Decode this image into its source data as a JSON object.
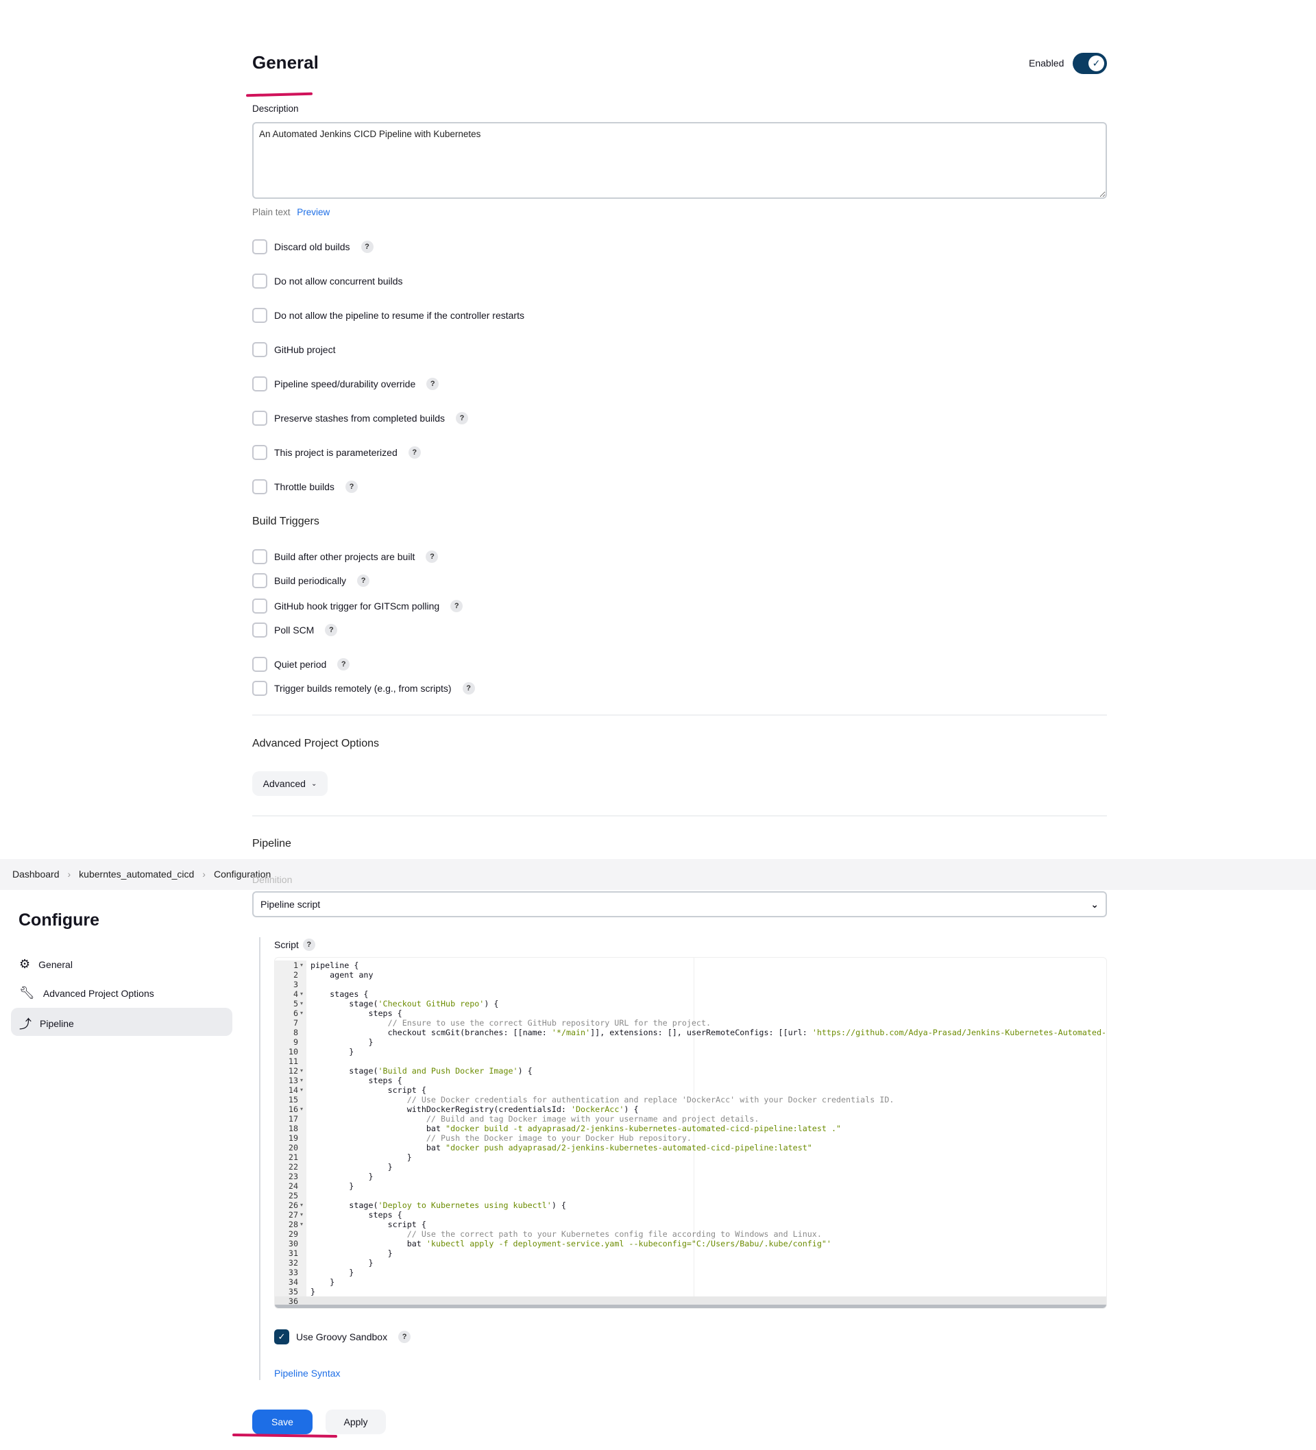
{
  "general": {
    "title": "General",
    "enabled_label": "Enabled",
    "enabled": true,
    "description_label": "Description",
    "description_value": "An Automated Jenkins CICD Pipeline with Kubernetes",
    "plain_text": "Plain text",
    "preview": "Preview",
    "options": [
      {
        "label": "Discard old builds",
        "help": true
      },
      {
        "label": "Do not allow concurrent builds",
        "help": false
      },
      {
        "label": "Do not allow the pipeline to resume if the controller restarts",
        "help": false
      },
      {
        "label": "GitHub project",
        "help": false
      },
      {
        "label": "Pipeline speed/durability override",
        "help": true
      },
      {
        "label": "Preserve stashes from completed builds",
        "help": true
      },
      {
        "label": "This project is parameterized",
        "help": true
      },
      {
        "label": "Throttle builds",
        "help": true
      }
    ]
  },
  "build_triggers": {
    "title": "Build Triggers",
    "options": [
      {
        "label": "Build after other projects are built"
      },
      {
        "label": "Build periodically"
      },
      {
        "label": "GitHub hook trigger for GITScm polling"
      },
      {
        "label": "Poll SCM"
      },
      {
        "label": "Quiet period"
      },
      {
        "label": "Trigger builds remotely (e.g., from scripts)"
      }
    ]
  },
  "advanced": {
    "title": "Advanced Project Options",
    "button": "Advanced"
  },
  "pipeline": {
    "title": "Pipeline",
    "definition_label": "Definition",
    "definition_value": "Pipeline script",
    "script_label": "Script",
    "groovy_sandbox": "Use Groovy Sandbox",
    "groovy_sandbox_checked": true,
    "syntax_link": "Pipeline Syntax",
    "fold_lines": [
      1,
      4,
      5,
      6,
      12,
      13,
      14,
      16,
      26,
      27,
      28
    ],
    "code": [
      "pipeline {",
      "    agent any",
      "",
      "    stages {",
      "        stage('Checkout GitHub repo') {",
      "            steps {",
      "                // Ensure to use the correct GitHub repository URL for the project.",
      "                checkout scmGit(branches: [[name: '*/main']], extensions: [], userRemoteConfigs: [[url: 'https://github.com/Adya-Prasad/Jenkins-Kubernetes-Automated-P",
      "            }",
      "        }",
      "",
      "        stage('Build and Push Docker Image') {",
      "            steps {",
      "                script {",
      "                    // Use Docker credentials for authentication and replace 'DockerAcc' with your Docker credentials ID.",
      "                    withDockerRegistry(credentialsId: 'DockerAcc') {",
      "                        // Build and tag Docker image with your username and project details.",
      "                        bat \"docker build -t adyaprasad/2-jenkins-kubernetes-automated-cicd-pipeline:latest .\"",
      "                        // Push the Docker image to your Docker Hub repository.",
      "                        bat \"docker push adyaprasad/2-jenkins-kubernetes-automated-cicd-pipeline:latest\"",
      "                    }",
      "                }",
      "            }",
      "        }",
      "",
      "        stage('Deploy to Kubernetes using kubectl') {",
      "            steps {",
      "                script {",
      "                    // Use the correct path to your Kubernetes config file according to Windows and Linux.",
      "                    bat 'kubectl apply -f deployment-service.yaml --kubeconfig=\"C:/Users/Babu/.kube/config\"'",
      "                }",
      "            }",
      "        }",
      "    }",
      "}",
      ""
    ]
  },
  "breadcrumb": [
    "Dashboard",
    "kuberntes_automated_cicd",
    "Configuration"
  ],
  "sidebar": {
    "title": "Configure",
    "items": [
      {
        "label": "General",
        "icon": "gear-icon"
      },
      {
        "label": "Advanced Project Options",
        "icon": "wrench-icon"
      },
      {
        "label": "Pipeline",
        "icon": "pipeline-icon",
        "active": true
      }
    ]
  },
  "actions": {
    "save": "Save",
    "apply": "Apply"
  },
  "colors": {
    "accent": "#1d6ee6",
    "toggle": "#0b3d63",
    "annotation": "#d0125a"
  }
}
